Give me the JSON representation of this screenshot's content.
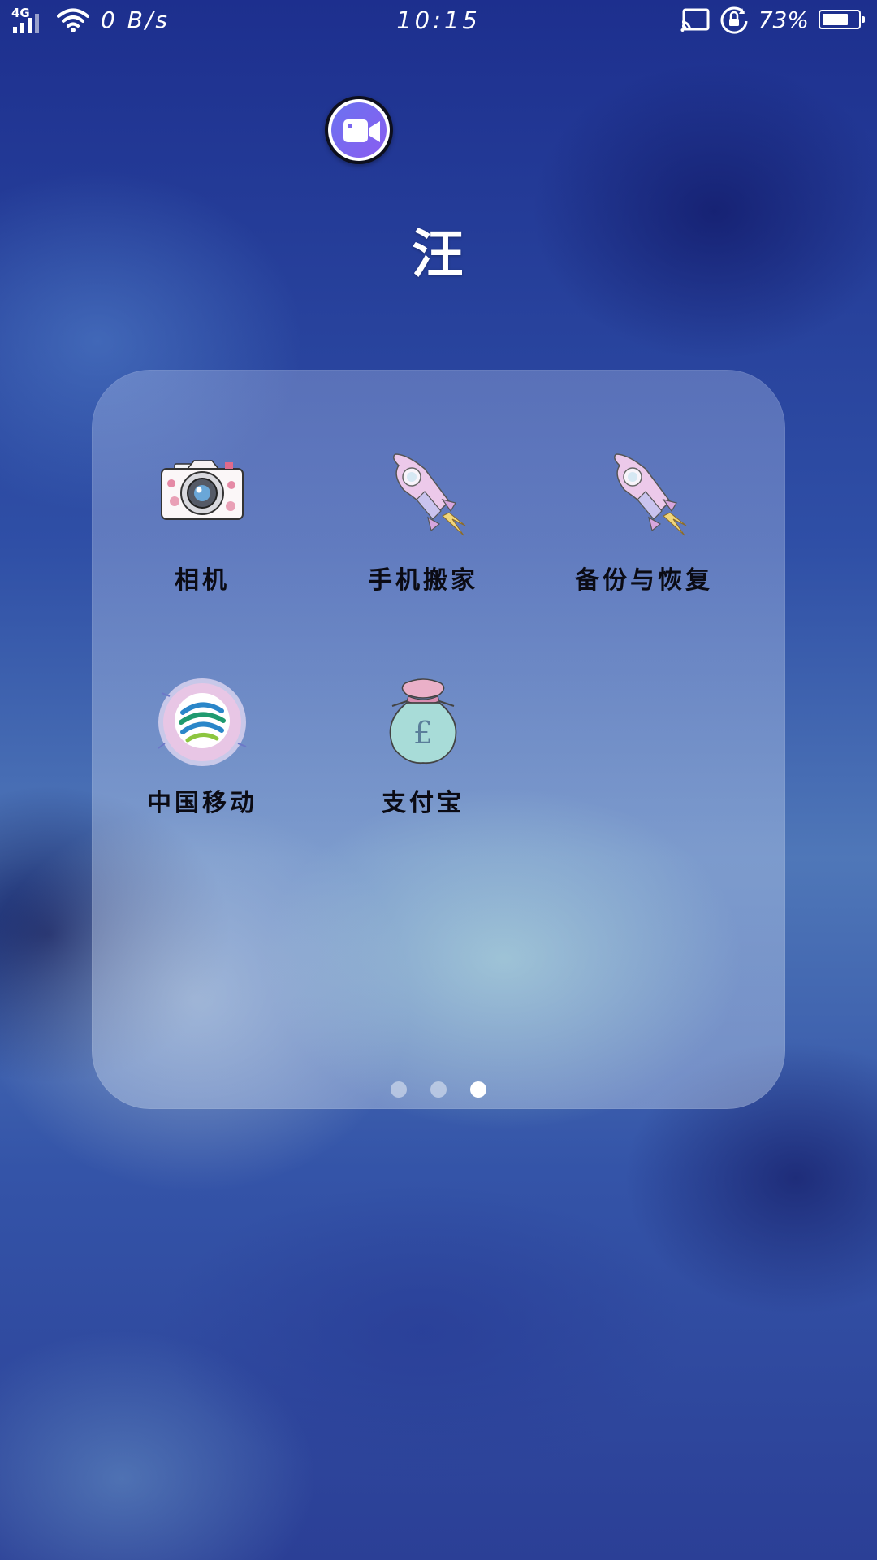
{
  "status_bar": {
    "network_type": "4G",
    "net_speed": "0 B/s",
    "time": "10:15",
    "battery_percent": "73%",
    "battery_level": 0.73,
    "icons": [
      "signal-icon",
      "wifi-icon",
      "cast-icon",
      "rotation-lock-icon",
      "battery-icon"
    ]
  },
  "floating_button": {
    "icon": "video-camera-icon",
    "color": "#7a66f0"
  },
  "folder": {
    "title": "汪",
    "apps": [
      {
        "label": "相机",
        "icon": "camera-icon"
      },
      {
        "label": "手机搬家",
        "icon": "rocket-icon"
      },
      {
        "label": "备份与恢复",
        "icon": "rocket-icon"
      },
      {
        "label": "中国移动",
        "icon": "china-mobile-icon"
      },
      {
        "label": "支付宝",
        "icon": "money-bag-icon"
      }
    ],
    "pages": {
      "total": 3,
      "current": 3
    }
  }
}
